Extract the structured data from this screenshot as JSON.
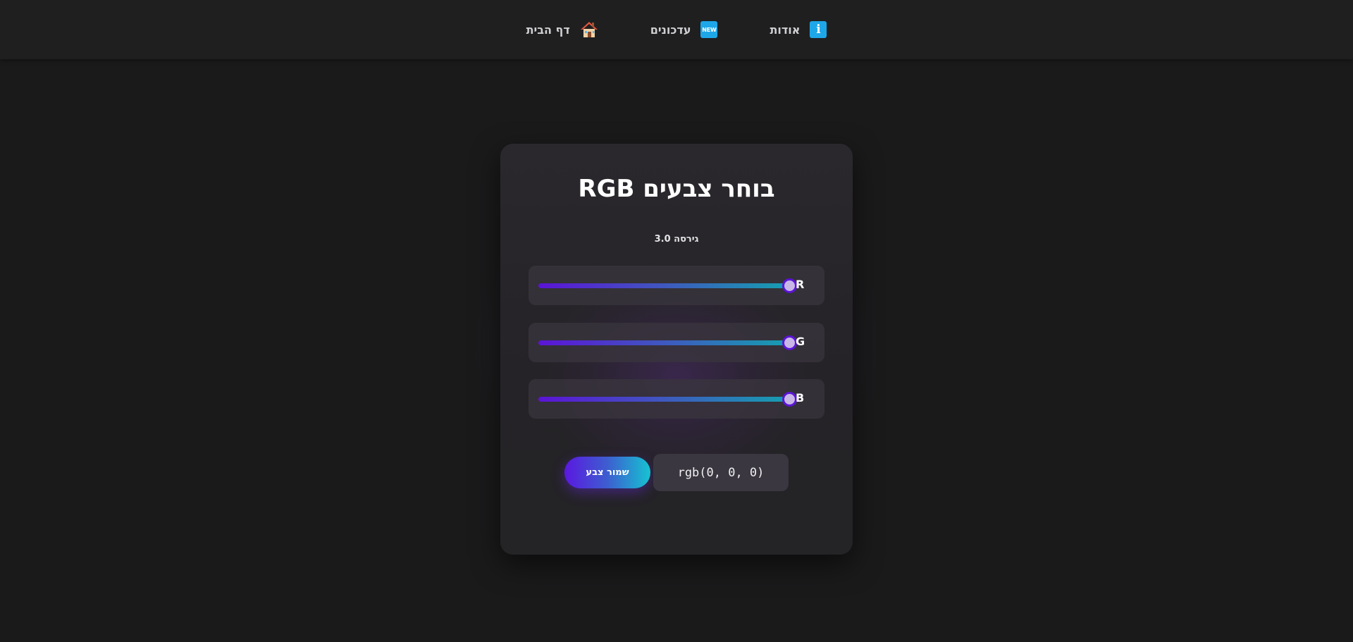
{
  "nav": {
    "items": [
      {
        "label": "דף הבית",
        "icon": "home-icon"
      },
      {
        "label": "עדכונים",
        "icon": "new-badge-icon",
        "badge_text": "NEW"
      },
      {
        "label": "אודות",
        "icon": "info-icon",
        "badge_text": "i"
      }
    ]
  },
  "card": {
    "title": "בוחר צבעים RGB",
    "version": "גירסה 3.0",
    "sliders": [
      {
        "label": "R",
        "value_fraction": 1.0
      },
      {
        "label": "G",
        "value_fraction": 1.0
      },
      {
        "label": "B",
        "value_fraction": 1.0
      }
    ],
    "save_button_label": "שמור צבע",
    "rgb_value": "rgb(0, 0, 0)"
  },
  "colors": {
    "accent_purple": "#5b14d6",
    "accent_teal": "#159fb0",
    "badge_blue": "#1ea7e8",
    "background": "#1a1a1b"
  }
}
